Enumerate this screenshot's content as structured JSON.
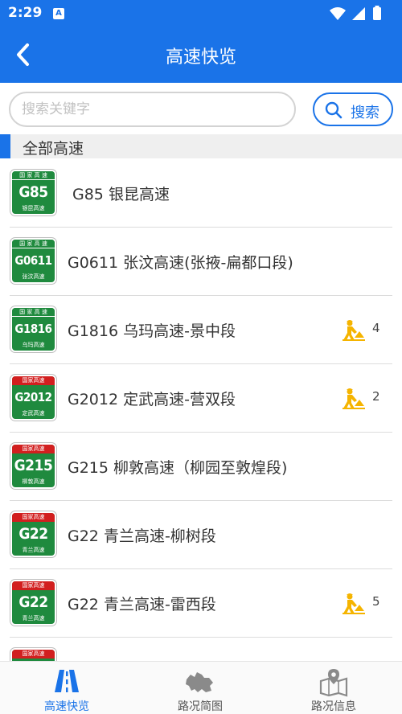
{
  "status_bar": {
    "time": "2:29",
    "notification_icon": "A"
  },
  "header": {
    "title": "高速快览"
  },
  "search": {
    "placeholder": "搜索关键字",
    "button_label": "搜索"
  },
  "section": {
    "title": "全部高速"
  },
  "roads": [
    {
      "code": "G85",
      "shield_top": "国 家 高 速",
      "shield_name": "银昆高速",
      "label": "G85 银昆高速",
      "work_count": ""
    },
    {
      "code": "G0611",
      "shield_top": "国 家 高 速",
      "shield_name": "张汶高速",
      "label": "G0611 张汶高速(张掖-扁都口段)",
      "work_count": ""
    },
    {
      "code": "G1816",
      "shield_top": "国 家 高 速",
      "shield_name": "乌玛高速",
      "label": "G1816 乌玛高速-景中段",
      "work_count": "4"
    },
    {
      "code": "G2012",
      "shield_top": "国家高速",
      "shield_name": "定武高速",
      "label": "G2012 定武高速-营双段",
      "work_count": "2"
    },
    {
      "code": "G215",
      "shield_top": "国家高速",
      "shield_name": "柳敦高速",
      "label": "G215 柳敦高速（柳园至敦煌段)",
      "work_count": ""
    },
    {
      "code": "G22",
      "shield_top": "国家高速",
      "shield_name": "青兰高速",
      "label": "G22 青兰高速-柳树段",
      "work_count": ""
    },
    {
      "code": "G22",
      "shield_top": "国家高速",
      "shield_name": "青兰高速",
      "label": "G22 青兰高速-雷西段",
      "work_count": "5"
    },
    {
      "code": "",
      "shield_top": "国家高速",
      "shield_name": "",
      "label": "",
      "work_count": ""
    }
  ],
  "tabs": [
    {
      "label": "高速快览",
      "icon": "road-icon",
      "active": true
    },
    {
      "label": "路况简图",
      "icon": "map-outline-icon",
      "active": false
    },
    {
      "label": "路况信息",
      "icon": "info-map-icon",
      "active": false
    }
  ],
  "colors": {
    "primary": "#1a73e8",
    "shield_green": "#1f8a3e",
    "shield_red": "#d21f1f",
    "work_icon": "#f5b400"
  }
}
